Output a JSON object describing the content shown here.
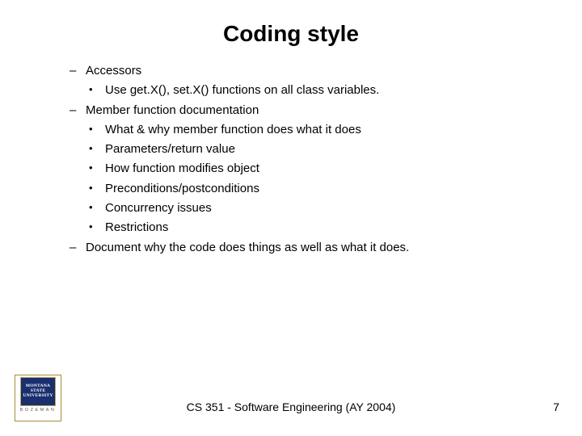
{
  "title": "Coding style",
  "items": [
    {
      "type": "dash",
      "text": "Accessors"
    },
    {
      "type": "dot",
      "text": "Use get.X(), set.X() functions on all class variables."
    },
    {
      "type": "dash",
      "text": "Member function documentation"
    },
    {
      "type": "dot",
      "text": "What & why member function does what it does"
    },
    {
      "type": "dot",
      "text": "Parameters/return value"
    },
    {
      "type": "dot",
      "text": "How function modifies object"
    },
    {
      "type": "dot",
      "text": "Preconditions/postconditions"
    },
    {
      "type": "dot",
      "text": "Concurrency issues"
    },
    {
      "type": "dot",
      "text": "Restrictions"
    },
    {
      "type": "dash",
      "text": "Document why the code does things as well as what it does."
    }
  ],
  "logo": {
    "crest_line1": "MONTANA",
    "crest_line2": "STATE UNIVERSITY",
    "subtext": "BOZEMAN"
  },
  "footer": "CS 351 - Software Engineering (AY 2004)",
  "page_number": "7"
}
